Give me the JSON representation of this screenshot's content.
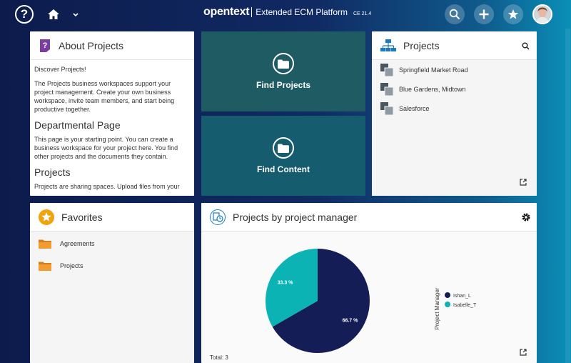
{
  "header": {
    "brand": "opentext",
    "product": "Extended ECM Platform",
    "version": "CE 21.4"
  },
  "about": {
    "title": "About Projects",
    "intro": "Discover Projects!",
    "para1": "The Projects business workspaces support your project management. Create your own business workspace, invite team members, and start being productive together.",
    "heading1": "Departmental Page",
    "para2": "This page is your starting point. You can create a business workspace for your project here. You find other projects and the documents they contain.",
    "heading2": "Projects",
    "para3": "Projects are sharing spaces. Upload files from your"
  },
  "find_projects": {
    "label": "Find Projects"
  },
  "find_content": {
    "label": "Find Content"
  },
  "projects": {
    "title": "Projects",
    "items": [
      "Springfield Market Road",
      "Blue Gardens, Midtown",
      "Salesforce"
    ]
  },
  "favorites": {
    "title": "Favorites",
    "items": [
      "Agreements",
      "Projects"
    ]
  },
  "chart_widget": {
    "title": "Projects by project manager",
    "total": "Total: 3"
  },
  "colors": {
    "teal_dark": "#1e5b63",
    "teal_mid": "#155d6e",
    "navy": "#141d55",
    "cyan": "#0bb3b5"
  },
  "chart_data": {
    "type": "pie",
    "legend_title": "Project Manager",
    "slices": [
      {
        "label": "Ishan_L",
        "value": 66.7,
        "value_label": "66.7 %",
        "color": "#141d55"
      },
      {
        "label": "Isabelle_T",
        "value": 33.3,
        "value_label": "33.3 %",
        "color": "#0bb3b5"
      }
    ],
    "legend_position": "right"
  }
}
